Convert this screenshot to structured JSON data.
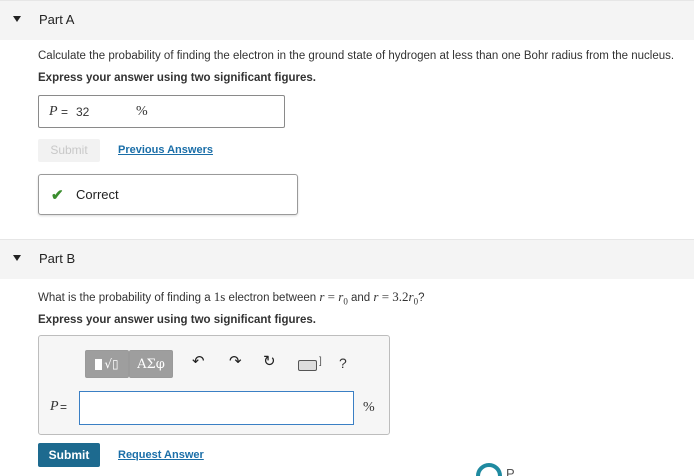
{
  "partA": {
    "title": "Part A",
    "question": "Calculate the probability of finding the electron in the ground state of hydrogen at less than one Bohr radius from the nucleus.",
    "instruction": "Express your answer using two significant figures.",
    "answer": {
      "variable": "P",
      "equals": "=",
      "value": "32",
      "unit": "%"
    },
    "submit_label": "Submit",
    "previous_answers_label": "Previous Answers",
    "feedback": {
      "check": "✔",
      "text": "Correct",
      "color": "#3a8d2e"
    }
  },
  "partB": {
    "title": "Part B",
    "question": {
      "pre": "What is the probability of finding a ",
      "orbital": "1s",
      "mid1": " electron between ",
      "r1": "r",
      "eq1": " = ",
      "r0a": "r",
      "r0a_sub": "0",
      "and": " and ",
      "r2": "r",
      "eq2": " = 3.2",
      "r0b": "r",
      "r0b_sub": "0",
      "end": "?"
    },
    "instruction": "Express your answer using two significant figures.",
    "editor": {
      "variable": "P",
      "equals": "=",
      "value": "",
      "unit": "%",
      "toolbar": {
        "templates_icon": "square-root-template-icon",
        "templates_symbol": "√▯",
        "greek_label": "ΑΣφ",
        "undo_icon": "undo-icon",
        "redo_icon": "redo-icon",
        "reset_icon": "reset-icon",
        "keyboard_icon": "keyboard-icon",
        "keyboard_suffix": "]",
        "help_label": "?"
      }
    },
    "submit_label": "Submit",
    "request_answer_label": "Request Answer"
  },
  "footer": {
    "logo_letter": "P"
  },
  "colors": {
    "accent": "#1d6a8f",
    "link": "#1a6ea8",
    "input_border": "#3a7fc4"
  }
}
